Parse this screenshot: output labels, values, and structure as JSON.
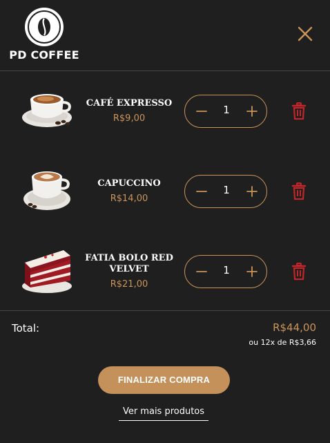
{
  "brand": {
    "name": "PD COFFEE"
  },
  "colors": {
    "background": "#201f1f",
    "accent": "#c9955a",
    "delete": "#c0262a",
    "text": "#ffffff"
  },
  "icons": {
    "close": "close-icon",
    "minus": "minus-icon",
    "plus": "plus-icon",
    "delete": "trash-icon"
  },
  "cart": {
    "items": [
      {
        "name": "CAFÉ EXPRESSO",
        "price": "R$9,00",
        "quantity": "1"
      },
      {
        "name": "CAPUCCINO",
        "price": "R$14,00",
        "quantity": "1"
      },
      {
        "name": "FATIA BOLO RED VELVET",
        "price": "R$21,00",
        "quantity": "1"
      }
    ]
  },
  "summary": {
    "total_label": "Total:",
    "total_value": "R$44,00",
    "installments": "ou 12x de R$3,66"
  },
  "actions": {
    "checkout_label": "FINALIZAR COMPRA",
    "more_label": "Ver mais produtos"
  }
}
